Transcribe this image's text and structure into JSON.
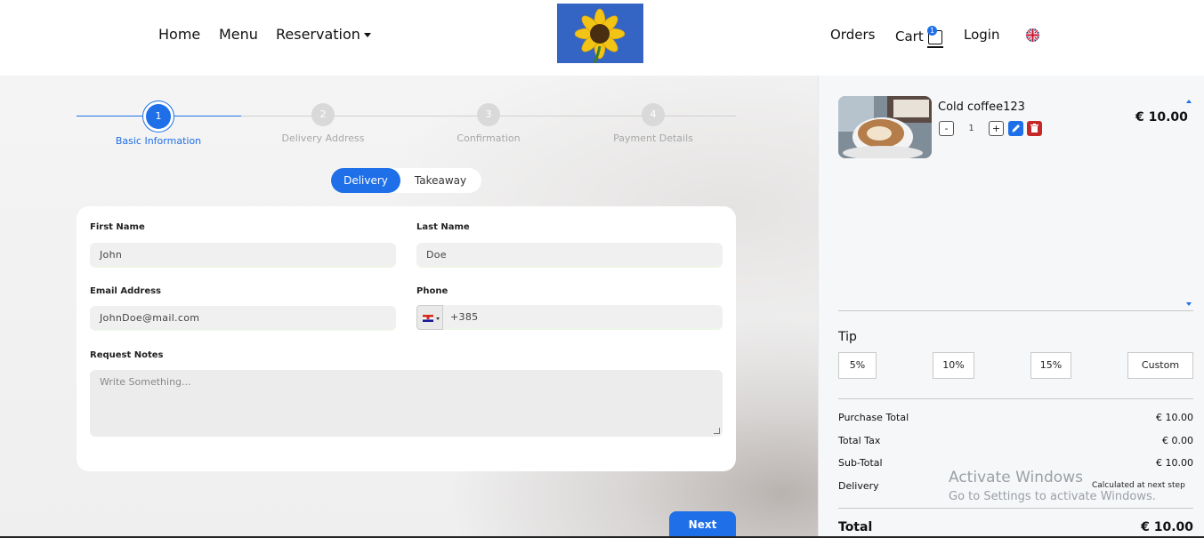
{
  "nav": {
    "home": "Home",
    "menu": "Menu",
    "reservation": "Reservation",
    "orders": "Orders",
    "cart": "Cart",
    "cart_count": "1",
    "login": "Login",
    "language_icon": "uk-flag-icon"
  },
  "colors": {
    "accent": "#1e6fe8",
    "danger": "#c62828"
  },
  "stepper": {
    "steps": [
      {
        "number": "1",
        "label": "Basic Information"
      },
      {
        "number": "2",
        "label": "Delivery Address"
      },
      {
        "number": "3",
        "label": "Confirmation"
      },
      {
        "number": "4",
        "label": "Payment Details"
      }
    ],
    "active_step": 1
  },
  "order_type": {
    "delivery": "Delivery",
    "takeaway": "Takeaway",
    "selected": "Delivery"
  },
  "form": {
    "first_name_label": "First Name",
    "first_name_value": "John",
    "last_name_label": "Last Name",
    "last_name_value": "Doe",
    "email_label": "Email Address",
    "email_value": "JohnDoe@mail.com",
    "phone_label": "Phone",
    "phone_value": "+385",
    "notes_label": "Request Notes",
    "notes_placeholder": "Write Something..."
  },
  "next_button": "Next",
  "cart": {
    "item_name": "Cold coffee123",
    "quantity": "1",
    "minus": "-",
    "plus": "+",
    "price": "€ 10.00"
  },
  "tip": {
    "title": "Tip",
    "options": [
      "5%",
      "10%",
      "15%",
      "Custom"
    ]
  },
  "summary": {
    "purchase_total_label": "Purchase Total",
    "purchase_total_value": "€ 10.00",
    "total_tax_label": "Total Tax",
    "total_tax_value": "€ 0.00",
    "subtotal_label": "Sub-Total",
    "subtotal_value": "€ 10.00",
    "delivery_label": "Delivery",
    "delivery_value": "Calculated at next step",
    "total_label": "Total",
    "total_value": "€ 10.00"
  },
  "watermark": {
    "line1": "Activate Windows",
    "line2": "Go to Settings to activate Windows."
  }
}
